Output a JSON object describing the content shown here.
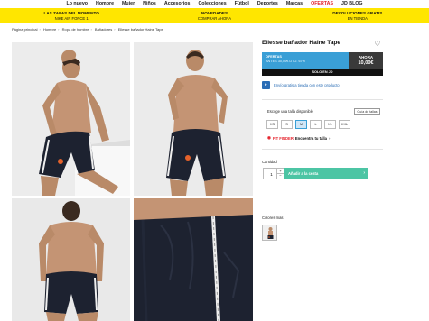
{
  "nav": {
    "items": [
      "Lo nuevo",
      "Hombre",
      "Mujer",
      "Niños",
      "Accesorios",
      "Colecciones",
      "Fútbol",
      "Deportes",
      "Marcas",
      "OFERTAS",
      "JD BLOG"
    ]
  },
  "promo": [
    {
      "title": "LAS ZAPAS DEL MOMENTO",
      "subtitle": "NIKE AIR FORCE 1"
    },
    {
      "title": "NOVEDADES",
      "subtitle": "COMPRAR AHORA"
    },
    {
      "title": "DEVOLUCIONES GRATIS",
      "subtitle": "EN TIENDA"
    }
  ],
  "breadcrumb": [
    "Página principal",
    "Hombre",
    "Ropa de hombre",
    "Bañadores",
    "Ellesse bañador Haine Tape"
  ],
  "product": {
    "title": "Ellesse bañador Haine Tape",
    "offer_label": "OFERTAS",
    "old_price_text": "ANTES 30,00€",
    "discount_text": "DTO. 67%",
    "now_label": "AHORA",
    "now_price": "10,00€",
    "only_label": "SOLO EN",
    "only_brand_icon": "jd-logo-icon",
    "delivery_text": "Envío gratis a tienda con este producto",
    "size_label": "Escoge una talla disponible",
    "size_guide": "Guía de tallas",
    "sizes": [
      "XS",
      "S",
      "M",
      "L",
      "XL",
      "XXL"
    ],
    "selected_size": "M",
    "fit_brand": "FIT FINDER",
    "fit_link": "Encuentra tu talla",
    "qty_label": "Cantidad",
    "qty_value": "1",
    "add_to_cart": "Añadir a la cesta",
    "colors_label": "Colores más"
  },
  "colors": {
    "accent_blue": "#3a9fd6",
    "promo_yellow": "#ffe600",
    "cta_green": "#4cc5a4",
    "sale_red": "#e5222b"
  }
}
